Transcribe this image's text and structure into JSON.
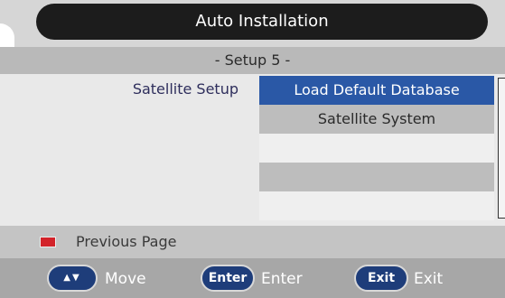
{
  "header": {
    "title": "Auto Installation"
  },
  "subheader": {
    "step": "- Setup 5 -"
  },
  "main": {
    "section_label": "Satellite Setup",
    "options": [
      {
        "label": "Load Default Database",
        "selected": true
      },
      {
        "label": "Satellite System",
        "selected": false
      }
    ]
  },
  "page_nav": {
    "color_key": "red",
    "label": "Previous Page"
  },
  "footer": {
    "move_key_glyph": "▲▼",
    "move_label": "Move",
    "enter_key": "Enter",
    "enter_label": "Enter",
    "exit_key": "Exit",
    "exit_label": "Exit"
  },
  "colors": {
    "selected_bg": "#2a58a6",
    "key_bg": "#1e3d7a",
    "red_key": "#d3232a",
    "title_bg": "#1c1c1c"
  }
}
